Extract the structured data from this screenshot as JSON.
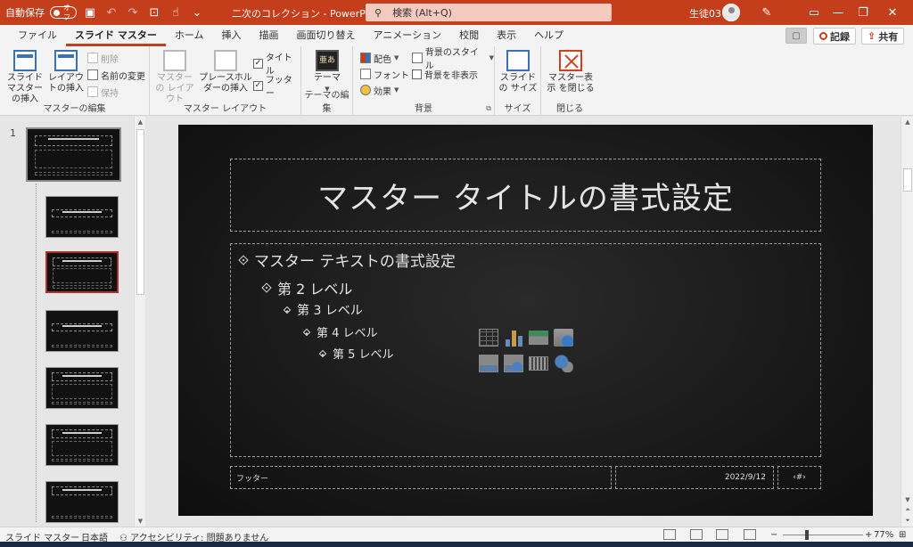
{
  "titlebar": {
    "autosave_label": "自動保存",
    "autosave_state": "オフ",
    "doc_title": "二次のコレクション - PowerPoint",
    "search_placeholder": "検索 (Alt+Q)",
    "user_name": "生徒03"
  },
  "tabs": [
    "ファイル",
    "スライド マスター",
    "ホーム",
    "挿入",
    "描画",
    "画面切り替え",
    "アニメーション",
    "校閲",
    "表示",
    "ヘルプ"
  ],
  "active_tab": "スライド マスター",
  "actions": {
    "record": "記録",
    "share": "共有"
  },
  "ribbon": {
    "master_edit": {
      "label": "マスターの編集",
      "insert_master": "スライド マスターの挿入",
      "insert_layout": "レイアウトの挿入",
      "delete": "削除",
      "rename": "名前の変更",
      "preserve": "保持"
    },
    "master_layout": {
      "label": "マスター レイアウト",
      "master_layout": "マスターの レイアウト",
      "insert_placeholder": "プレースホルダーの挿入",
      "title_check": "タイトル",
      "footer_check": "フッター"
    },
    "theme_edit": {
      "label": "テーマの編集",
      "theme": "テーマ",
      "theme_icon_text": "亜あ"
    },
    "background": {
      "label": "背景",
      "colors": "配色",
      "fonts": "フォント",
      "effects": "効果",
      "bg_styles": "背景のスタイル",
      "hide_bg": "背景を非表示"
    },
    "size": {
      "label": "サイズ",
      "slide_size": "スライドの サイズ"
    },
    "close": {
      "label": "閉じる",
      "close_master": "マスター表示 を閉じる"
    }
  },
  "thumbnails": {
    "slide_number": "1"
  },
  "slide": {
    "title": "マスター タイトルの書式設定",
    "levels": [
      "マスター テキストの書式設定",
      "第 2 レベル",
      "第 3 レベル",
      "第 4 レベル",
      "第 5 レベル"
    ],
    "footer": "フッター",
    "date": "2022/9/12",
    "page_number": "‹#›"
  },
  "statusbar": {
    "view": "スライド マスター",
    "language": "日本語",
    "accessibility": "アクセシビリティ: 問題ありません",
    "zoom": "77%"
  },
  "colors": {
    "accent": "#c43e1c"
  }
}
